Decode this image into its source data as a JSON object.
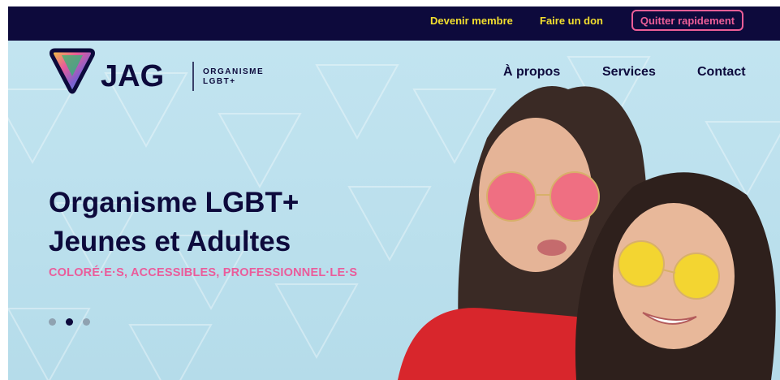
{
  "topbar": {
    "links": [
      "Devenir membre",
      "Faire un don"
    ],
    "quick_exit_label": "Quitter rapidement"
  },
  "header": {
    "logo": {
      "name": "JAG",
      "subtitle_line1": "ORGANISME",
      "subtitle_line2": "LGBT+"
    },
    "nav": [
      "À propos",
      "Services",
      "Contact"
    ]
  },
  "hero": {
    "title_line1": "Organisme LGBT+",
    "title_line2": "Jeunes et Adultes",
    "tagline": "COLORÉ·E·S, ACCESSIBLES, PROFESSIONNEL·LE·S",
    "slides": {
      "count": 3,
      "active": 2
    }
  },
  "colors": {
    "topbar": "#0d0a3c",
    "link_yellow": "#f3df2e",
    "accent_pink": "#ec5e97",
    "hero_bg": "#bfe3ef",
    "text_navy": "#0d0a3c"
  }
}
